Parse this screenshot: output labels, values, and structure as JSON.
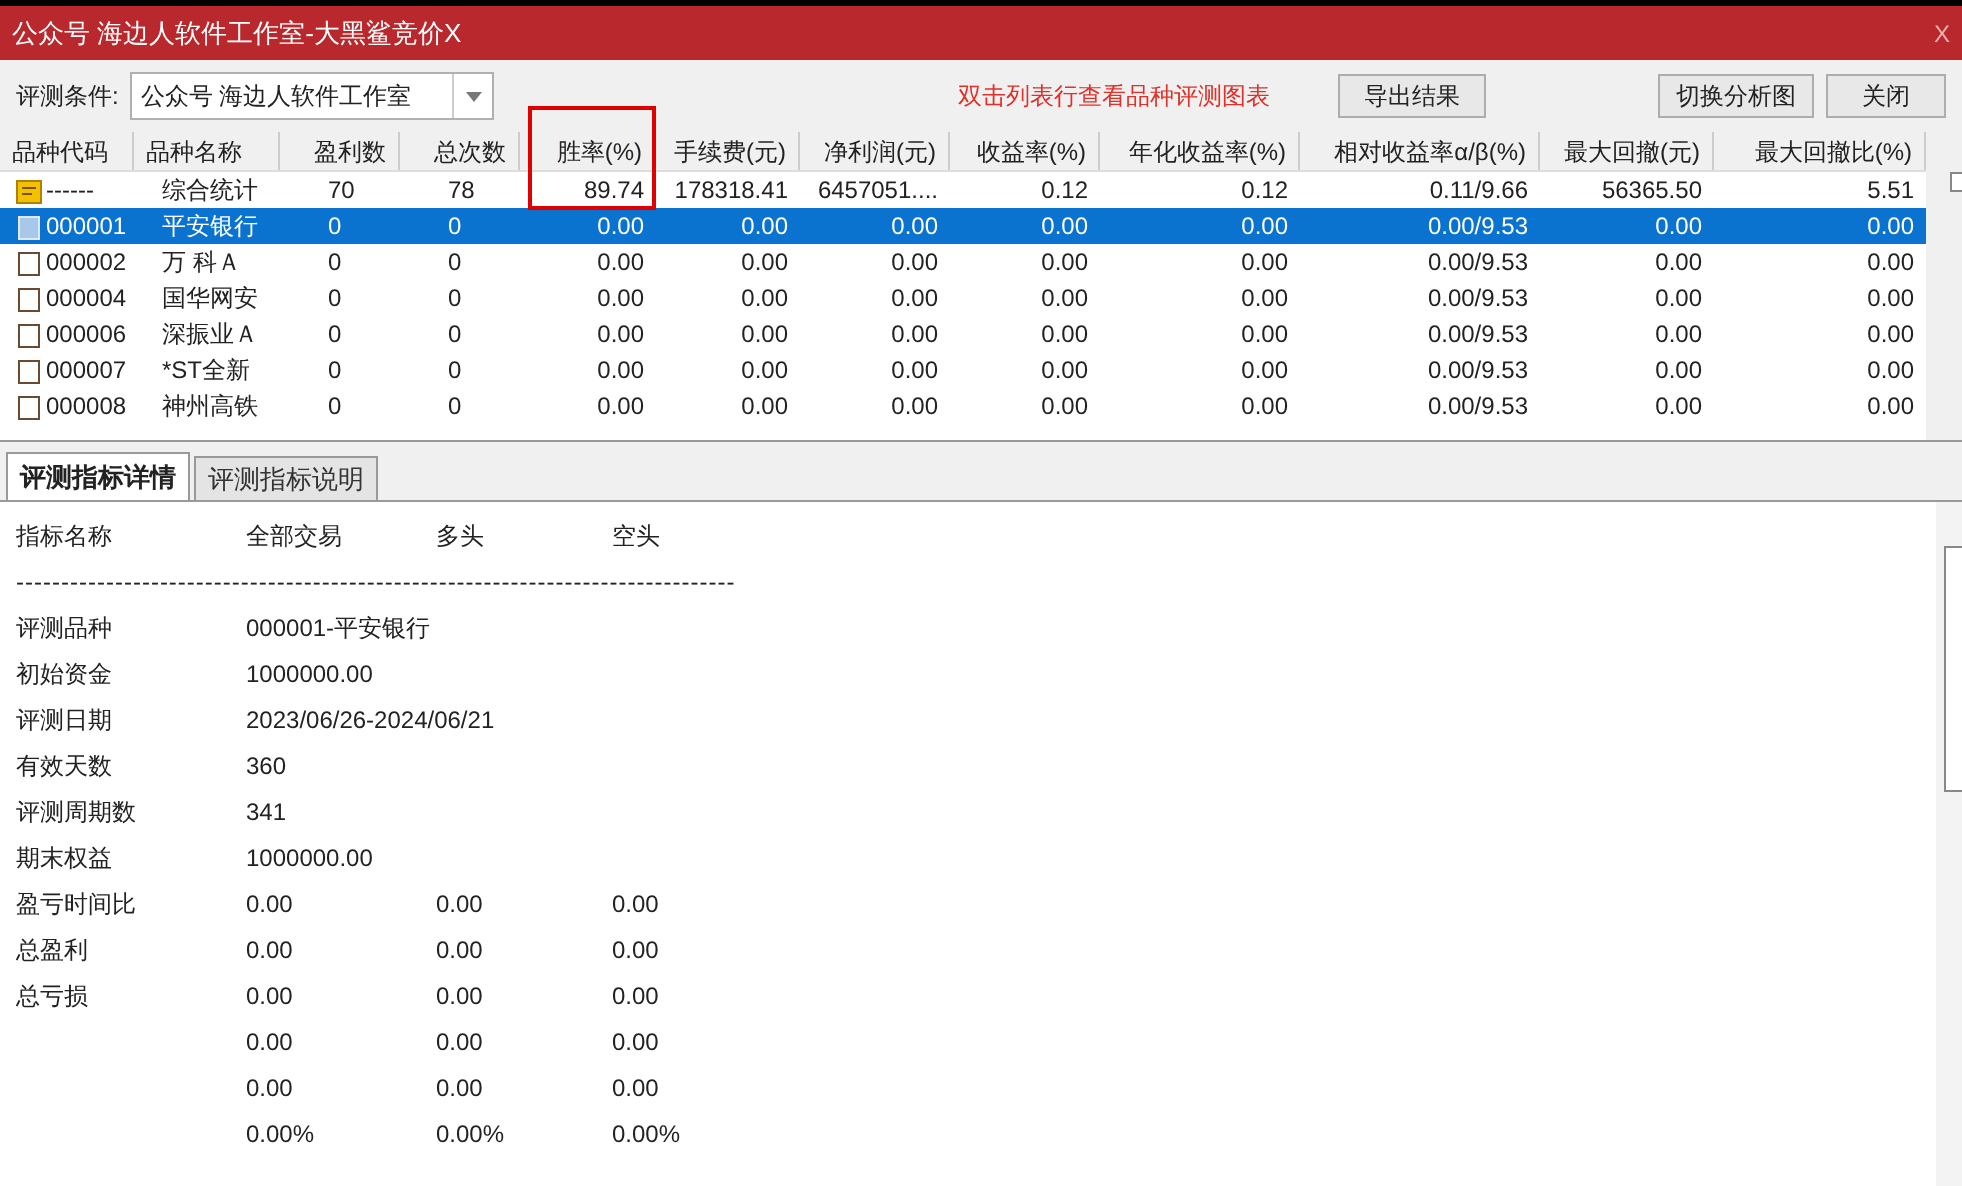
{
  "window": {
    "title": "公众号 海边人软件工作室-大黑鲨竞价X",
    "close": "X"
  },
  "toolbar": {
    "condition_label": "评测条件:",
    "condition_value": "公众号 海边人软件工作室",
    "hint": "双击列表行查看品种评测图表",
    "buttons": [
      "导出结果",
      "切换分析图",
      "关闭"
    ]
  },
  "table": {
    "columns": [
      {
        "label": "品种代码",
        "highlighted": false
      },
      {
        "label": "品种名称",
        "highlighted": false
      },
      {
        "label": "盈利数",
        "highlighted": false
      },
      {
        "label": "总次数",
        "highlighted": false
      },
      {
        "label": "胜率(%)",
        "highlighted": true
      },
      {
        "label": "手续费(元)",
        "highlighted": false
      },
      {
        "label": "净利润(元)",
        "highlighted": false
      },
      {
        "label": "收益率(%)",
        "highlighted": false
      },
      {
        "label": "年化收益率(%)",
        "highlighted": false
      },
      {
        "label": "相对收益率α/β(%)",
        "highlighted": false
      },
      {
        "label": "最大回撤(元)",
        "highlighted": false
      },
      {
        "label": "最大回撤比(%)",
        "highlighted": false
      }
    ],
    "rows": [
      {
        "kind": "summary",
        "selected": false,
        "cells": [
          "------",
          "综合统计",
          "70",
          "78",
          "89.74",
          "178318.41",
          "6457051....",
          "0.12",
          "0.12",
          "0.11/9.66",
          "56365.50",
          "5.51"
        ]
      },
      {
        "kind": "stock",
        "selected": true,
        "cells": [
          "000001",
          "平安银行",
          "0",
          "0",
          "0.00",
          "0.00",
          "0.00",
          "0.00",
          "0.00",
          "0.00/9.53",
          "0.00",
          "0.00"
        ]
      },
      {
        "kind": "stock",
        "selected": false,
        "cells": [
          "000002",
          "万 科Ａ",
          "0",
          "0",
          "0.00",
          "0.00",
          "0.00",
          "0.00",
          "0.00",
          "0.00/9.53",
          "0.00",
          "0.00"
        ]
      },
      {
        "kind": "stock",
        "selected": false,
        "cells": [
          "000004",
          "国华网安",
          "0",
          "0",
          "0.00",
          "0.00",
          "0.00",
          "0.00",
          "0.00",
          "0.00/9.53",
          "0.00",
          "0.00"
        ]
      },
      {
        "kind": "stock",
        "selected": false,
        "cells": [
          "000006",
          "深振业Ａ",
          "0",
          "0",
          "0.00",
          "0.00",
          "0.00",
          "0.00",
          "0.00",
          "0.00/9.53",
          "0.00",
          "0.00"
        ]
      },
      {
        "kind": "stock",
        "selected": false,
        "cells": [
          "000007",
          "*ST全新",
          "0",
          "0",
          "0.00",
          "0.00",
          "0.00",
          "0.00",
          "0.00",
          "0.00/9.53",
          "0.00",
          "0.00"
        ]
      },
      {
        "kind": "stock",
        "selected": false,
        "cells": [
          "000008",
          "神州高铁",
          "0",
          "0",
          "0.00",
          "0.00",
          "0.00",
          "0.00",
          "0.00",
          "0.00/9.53",
          "0.00",
          "0.00"
        ]
      }
    ]
  },
  "tabs": [
    {
      "label": "评测指标详情",
      "selected": true
    },
    {
      "label": "评测指标说明",
      "selected": false
    }
  ],
  "details": {
    "columns": [
      "指标名称",
      "全部交易",
      "多头",
      "空头"
    ],
    "separator": "--------------------------------------------------------------------------------",
    "rows": [
      {
        "label": "评测品种",
        "values": [
          "000001-平安银行"
        ]
      },
      {
        "label": "初始资金",
        "values": [
          "1000000.00"
        ]
      },
      {
        "label": "评测日期",
        "values": [
          "2023/06/26-2024/06/21"
        ]
      },
      {
        "label": "有效天数",
        "values": [
          "360"
        ]
      },
      {
        "label": "评测周期数",
        "values": [
          "341"
        ]
      },
      {
        "label": "期末权益",
        "values": [
          "1000000.00"
        ]
      },
      {
        "label": "盈亏时间比",
        "values": [
          "0.00",
          "0.00",
          "0.00"
        ]
      },
      {
        "label": "总盈利",
        "values": [
          "0.00",
          "0.00",
          "0.00"
        ]
      },
      {
        "label": "总亏损",
        "values": [
          "0.00",
          "0.00",
          "0.00"
        ]
      },
      {
        "values": [
          "0.00",
          "0.00",
          "0.00"
        ]
      },
      {
        "values": [
          "0.00",
          "0.00",
          "0.00"
        ]
      },
      {
        "values": [
          "0.00%",
          "0.00%",
          "0.00%"
        ]
      }
    ]
  }
}
